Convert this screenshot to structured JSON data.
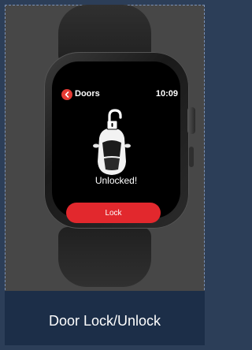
{
  "watch": {
    "screen_title": "Doors",
    "time": "10:09",
    "status_text": "Unlocked!",
    "lock_button_label": "Lock",
    "icons": {
      "back": "chevron-left-icon",
      "car": "car-top-view-icon",
      "lock": "unlocked-padlock-icon"
    }
  },
  "caption": "Door Lock/Unlock",
  "colors": {
    "background": "#2c3e58",
    "caption_bar": "#1c2e48",
    "accent_red": "#e2282d",
    "screen": "#000000"
  }
}
